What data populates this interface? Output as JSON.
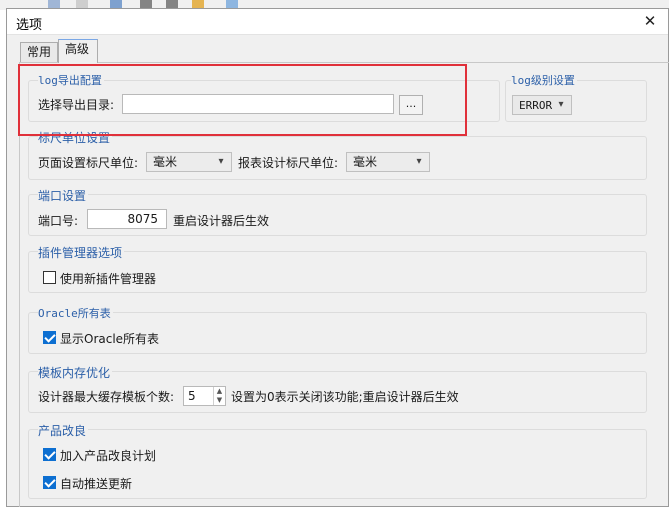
{
  "dialog": {
    "title": "选项",
    "close_glyph": "✕"
  },
  "tabs": [
    {
      "label": "常用",
      "active": false
    },
    {
      "label": "高级",
      "active": true
    }
  ],
  "log_export": {
    "title": "log导出配置",
    "dir_label": "选择导出目录:",
    "dir_value": "",
    "browse_label": "..."
  },
  "log_level": {
    "title": "log级别设置",
    "value": "ERROR"
  },
  "ruler": {
    "title": "标尺单位设置",
    "page_label": "页面设置标尺单位:",
    "page_value": "毫米",
    "report_label": "报表设计标尺单位:",
    "report_value": "毫米"
  },
  "port": {
    "title": "端口设置",
    "label": "端口号:",
    "value": "8075",
    "note": "重启设计器后生效"
  },
  "plugin": {
    "title": "插件管理器选项",
    "checkbox_label": "使用新插件管理器",
    "checked": false
  },
  "oracle": {
    "title": "Oracle所有表",
    "checkbox_label": "显示Oracle所有表",
    "checked": true
  },
  "memory": {
    "title": "模板内存优化",
    "label": "设计器最大缓存模板个数:",
    "value": "5",
    "note": "设置为0表示关闭该功能;重启设计器后生效"
  },
  "improve": {
    "title": "产品改良",
    "items": [
      {
        "label": "加入产品改良计划",
        "checked": true
      },
      {
        "label": "自动推送更新",
        "checked": true
      }
    ]
  },
  "colors": {
    "accent": "#0d6fd1",
    "group_title": "#2b5fa8",
    "highlight": "#e0303a"
  }
}
